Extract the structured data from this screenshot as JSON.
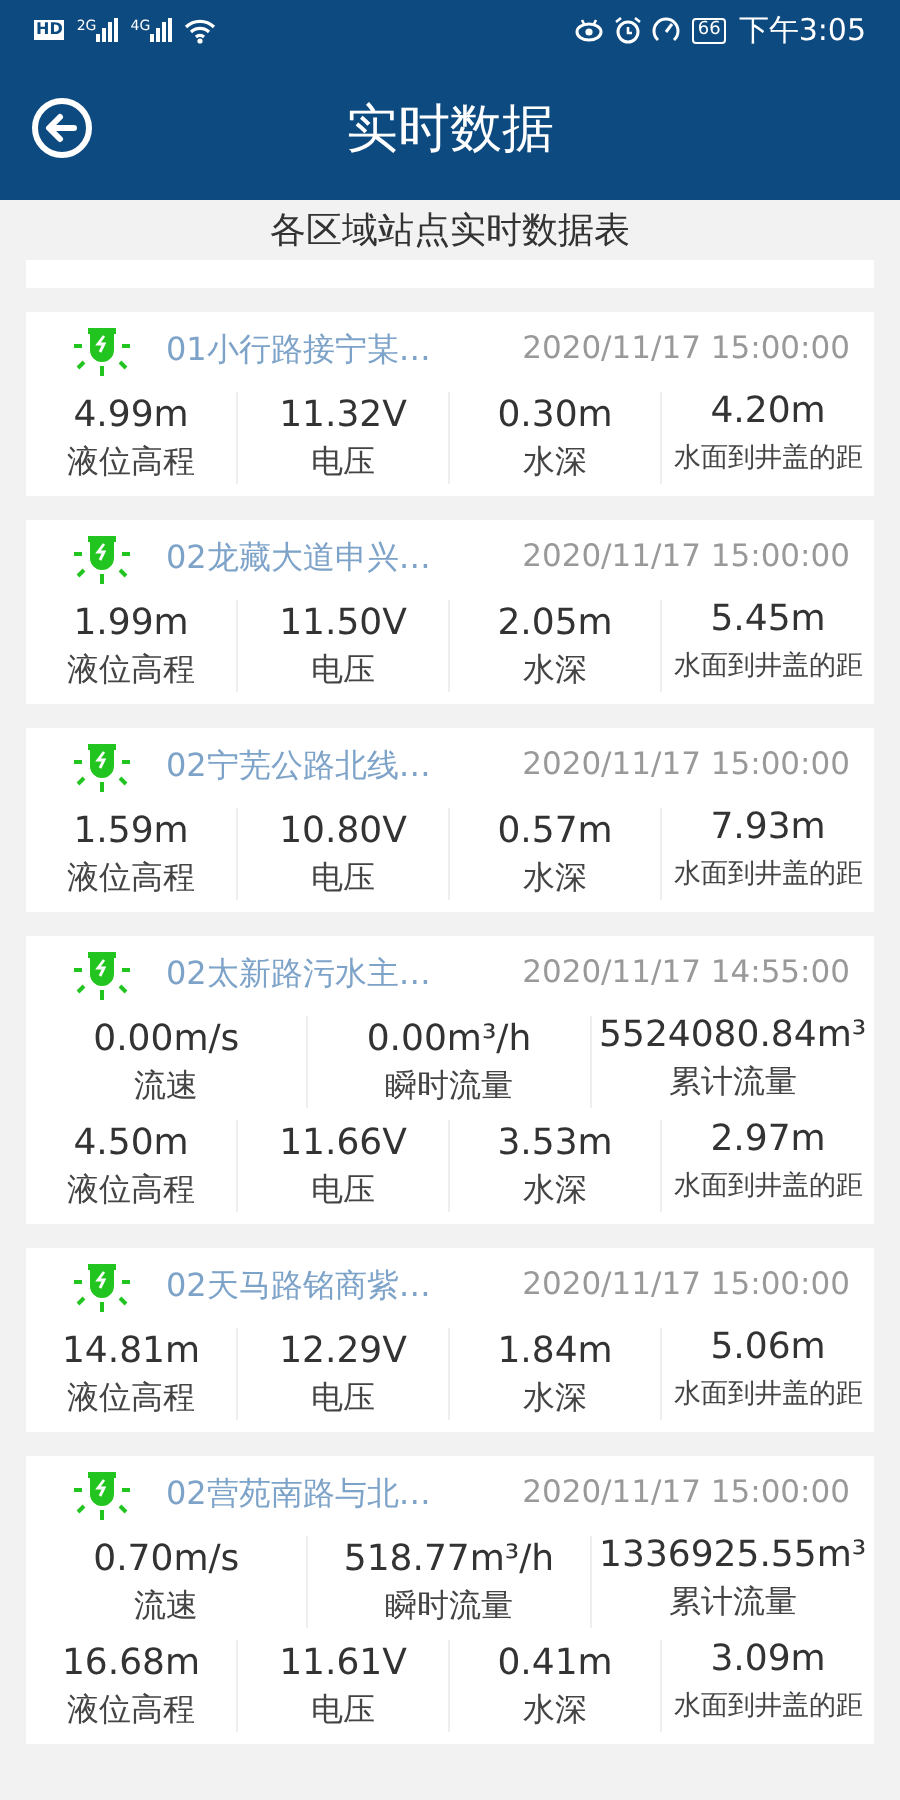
{
  "status_bar": {
    "hd": "HD",
    "networks": [
      "2G",
      "4G"
    ],
    "battery": "66",
    "time": "下午3:05"
  },
  "header": {
    "title": "实时数据"
  },
  "subtitle": "各区域站点实时数据表",
  "stations": [
    {
      "name": "01小行路接宁某…",
      "time": "2020/11/17 15:00:00",
      "metrics": [
        {
          "value": "4.99m",
          "label": "液位高程"
        },
        {
          "value": "11.32V",
          "label": "电压"
        },
        {
          "value": "0.30m",
          "label": "水深"
        },
        {
          "value": "4.20m",
          "label": "水面到井盖的距"
        }
      ]
    },
    {
      "name": "02龙藏大道申兴…",
      "time": "2020/11/17 15:00:00",
      "metrics": [
        {
          "value": "1.99m",
          "label": "液位高程"
        },
        {
          "value": "11.50V",
          "label": "电压"
        },
        {
          "value": "2.05m",
          "label": "水深"
        },
        {
          "value": "5.45m",
          "label": "水面到井盖的距"
        }
      ]
    },
    {
      "name": "02宁芜公路北线…",
      "time": "2020/11/17 15:00:00",
      "metrics": [
        {
          "value": "1.59m",
          "label": "液位高程"
        },
        {
          "value": "10.80V",
          "label": "电压"
        },
        {
          "value": "0.57m",
          "label": "水深"
        },
        {
          "value": "7.93m",
          "label": "水面到井盖的距"
        }
      ]
    },
    {
      "name": "02太新路污水主…",
      "time": "2020/11/17 14:55:00",
      "flow": [
        {
          "value": "0.00m/s",
          "label": "流速"
        },
        {
          "value": "0.00m³/h",
          "label": "瞬时流量"
        },
        {
          "value": "5524080.84m³",
          "label": "累计流量"
        }
      ],
      "metrics": [
        {
          "value": "4.50m",
          "label": "液位高程"
        },
        {
          "value": "11.66V",
          "label": "电压"
        },
        {
          "value": "3.53m",
          "label": "水深"
        },
        {
          "value": "2.97m",
          "label": "水面到井盖的距"
        }
      ]
    },
    {
      "name": "02天马路铭商紫…",
      "time": "2020/11/17 15:00:00",
      "metrics": [
        {
          "value": "14.81m",
          "label": "液位高程"
        },
        {
          "value": "12.29V",
          "label": "电压"
        },
        {
          "value": "1.84m",
          "label": "水深"
        },
        {
          "value": "5.06m",
          "label": "水面到井盖的距"
        }
      ]
    },
    {
      "name": "02营苑南路与北…",
      "time": "2020/11/17 15:00:00",
      "flow": [
        {
          "value": "0.70m/s",
          "label": "流速"
        },
        {
          "value": "518.77m³/h",
          "label": "瞬时流量"
        },
        {
          "value": "1336925.55m³",
          "label": "累计流量"
        }
      ],
      "metrics": [
        {
          "value": "16.68m",
          "label": "液位高程"
        },
        {
          "value": "11.61V",
          "label": "电压"
        },
        {
          "value": "0.41m",
          "label": "水深"
        },
        {
          "value": "3.09m",
          "label": "水面到井盖的距"
        }
      ]
    }
  ]
}
